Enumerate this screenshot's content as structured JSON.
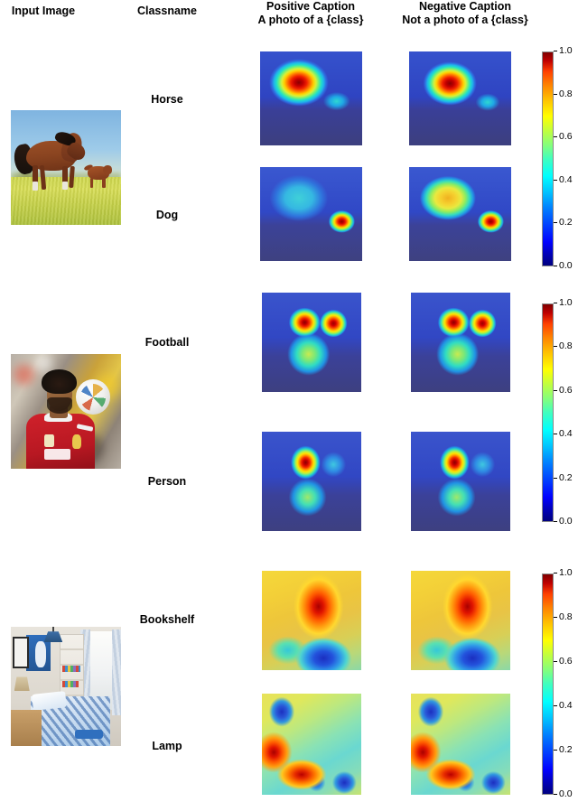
{
  "figure": {
    "kind": "gradcam-grid",
    "columns": [
      {
        "name": "input-image",
        "line1": "Input Image",
        "line2": ""
      },
      {
        "name": "classname",
        "line1": "Classname",
        "line2": ""
      },
      {
        "name": "positive-caption",
        "line1": "Positive Caption",
        "line2": "A photo of a {class}"
      },
      {
        "name": "negative-caption",
        "line1": "Negative Caption",
        "line2": "Not a photo of a {class}"
      }
    ],
    "groups": [
      {
        "image_name": "horse-and-dog-in-field",
        "image_alt": "Brown horse and small dog standing on a green grass field under blue sky",
        "rows": [
          {
            "classname": "Horse",
            "positive_name": "heatmap-horse-positive",
            "negative_name": "heatmap-horse-negative"
          },
          {
            "classname": "Dog",
            "positive_name": "heatmap-dog-positive",
            "negative_name": "heatmap-dog-negative"
          }
        ]
      },
      {
        "image_name": "footballer-with-ball",
        "image_alt": "Footballer in a red jersey heading a white football",
        "rows": [
          {
            "classname": "Football",
            "positive_name": "heatmap-football-positive",
            "negative_name": "heatmap-football-negative"
          },
          {
            "classname": "Person",
            "positive_name": "heatmap-person-positive",
            "negative_name": "heatmap-person-negative"
          }
        ]
      },
      {
        "image_name": "childrens-bedroom",
        "image_alt": "Children's bedroom with a bookshelf, hanging lamp, window and blue patterned bed",
        "rows": [
          {
            "classname": "Bookshelf",
            "positive_name": "heatmap-bookshelf-positive",
            "negative_name": "heatmap-bookshelf-negative"
          },
          {
            "classname": "Lamp",
            "positive_name": "heatmap-lamp-positive",
            "negative_name": "heatmap-lamp-negative"
          }
        ]
      }
    ],
    "colorbars": [
      {
        "name": "colorbar-group-1",
        "ticks": [
          "0.0",
          "0.2",
          "0.4",
          "0.6",
          "0.8",
          "1.0"
        ]
      },
      {
        "name": "colorbar-group-2",
        "ticks": [
          "0.0",
          "0.2",
          "0.4",
          "0.6",
          "0.8",
          "1.0"
        ]
      },
      {
        "name": "colorbar-group-3",
        "ticks": [
          "0.0",
          "0.2",
          "0.4",
          "0.6",
          "0.8",
          "1.0"
        ]
      }
    ]
  },
  "chart_data": {
    "type": "heatmap",
    "title": "",
    "colormap": "jet",
    "vmin": 0.0,
    "vmax": 1.0,
    "colorbar_ticks": [
      0.0,
      0.2,
      0.4,
      0.6,
      0.8,
      1.0
    ],
    "row_labels": [
      "Horse",
      "Dog",
      "Football",
      "Person",
      "Bookshelf",
      "Lamp"
    ],
    "column_labels": [
      "Input Image",
      "Classname",
      "Positive Caption",
      "Negative Caption"
    ],
    "panels": [
      {
        "row": "Horse",
        "condition": "positive",
        "peak_value": 1.0,
        "peak_location": "horse body",
        "background_value": 0.15
      },
      {
        "row": "Horse",
        "condition": "negative",
        "peak_value": 1.0,
        "peak_location": "horse body",
        "background_value": 0.15
      },
      {
        "row": "Dog",
        "condition": "positive",
        "peak_value": 1.0,
        "peak_location": "dog at right",
        "background_value": 0.2
      },
      {
        "row": "Dog",
        "condition": "negative",
        "peak_value": 1.0,
        "peak_location": "dog at right plus warm horse",
        "background_value": 0.25
      },
      {
        "row": "Football",
        "condition": "positive",
        "peak_value": 1.0,
        "peak_location": "face and ball",
        "background_value": 0.15
      },
      {
        "row": "Football",
        "condition": "negative",
        "peak_value": 1.0,
        "peak_location": "face and ball",
        "background_value": 0.15
      },
      {
        "row": "Person",
        "condition": "positive",
        "peak_value": 1.0,
        "peak_location": "face",
        "background_value": 0.15
      },
      {
        "row": "Person",
        "condition": "negative",
        "peak_value": 1.0,
        "peak_location": "face",
        "background_value": 0.15
      },
      {
        "row": "Bookshelf",
        "condition": "positive",
        "peak_value": 1.0,
        "peak_location": "shelf column centre",
        "background_value": 0.65
      },
      {
        "row": "Bookshelf",
        "condition": "negative",
        "peak_value": 1.0,
        "peak_location": "shelf column centre",
        "background_value": 0.65
      },
      {
        "row": "Lamp",
        "condition": "positive",
        "peak_value": 1.0,
        "peak_location": "left wall and bed foreground",
        "background_value": 0.55
      },
      {
        "row": "Lamp",
        "condition": "negative",
        "peak_value": 1.0,
        "peak_location": "left wall and bed foreground",
        "background_value": 0.55
      }
    ]
  }
}
